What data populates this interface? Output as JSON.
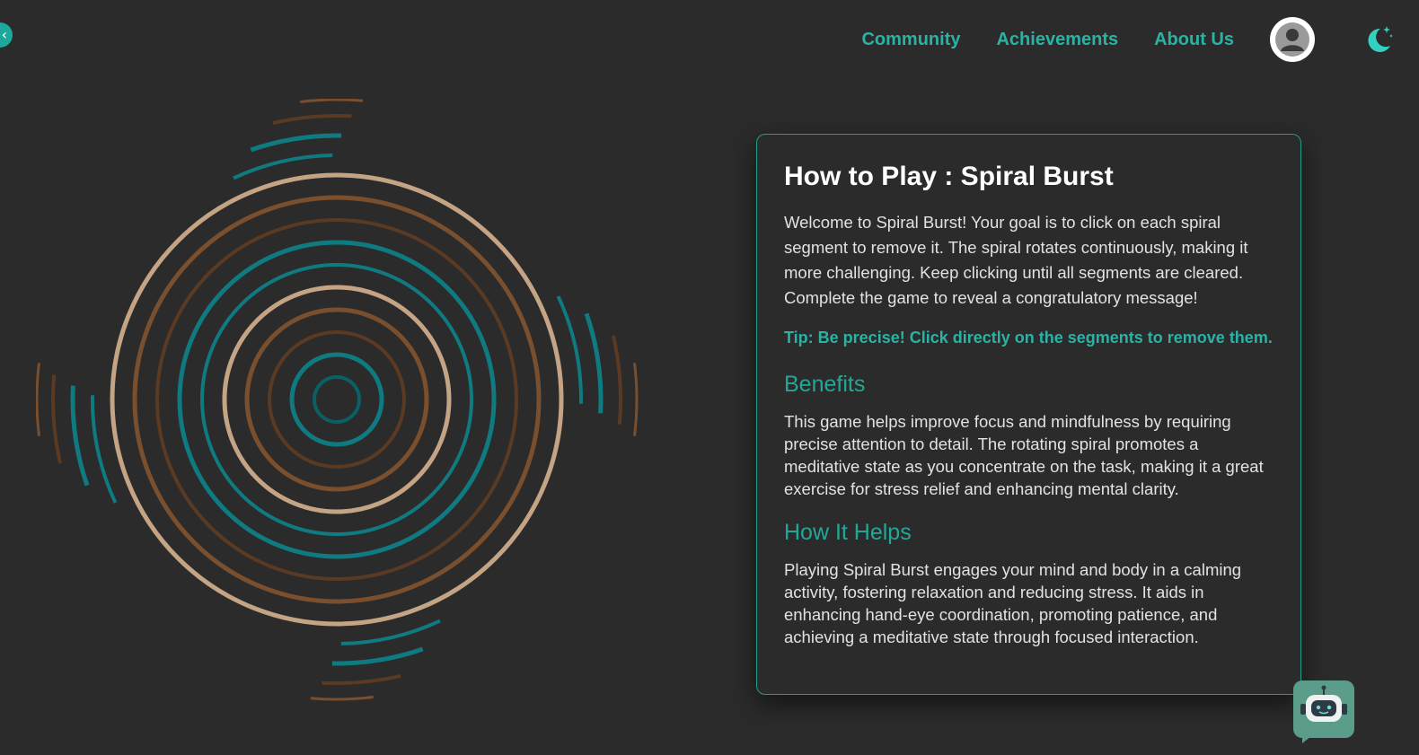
{
  "nav": {
    "items": [
      {
        "label": "Community"
      },
      {
        "label": "Achievements"
      },
      {
        "label": "About Us"
      }
    ],
    "avatar_icon": "user-avatar-icon",
    "theme_toggle_icon": "moon-stars-icon",
    "back_icon": "chevron-left-icon"
  },
  "card": {
    "title": "How to Play : Spiral Burst",
    "intro": "Welcome to Spiral Burst! Your goal is to click on each spiral segment to remove it. The spiral rotates continuously, making it more challenging. Keep clicking until all segments are cleared. Complete the game to reveal a congratulatory message!",
    "tip": "Tip: Be precise! Click directly on the segments to remove them.",
    "benefits_heading": "Benefits",
    "benefits_text": "This game helps improve focus and mindfulness by requiring precise attention to detail. The rotating spiral promotes a meditative state as you concentrate on the task, making it a great exercise for stress relief and enhancing mental clarity.",
    "helps_heading": "How It Helps",
    "helps_text": "Playing Spiral Burst engages your mind and body in a calming activity, fostering relaxation and reducing stress. It aids in enhancing hand-eye coordination, promoting patience, and achieving a meditative state through focused interaction."
  },
  "chatbot": {
    "icon": "robot-icon"
  },
  "colors": {
    "background": "#2b2b2b",
    "accent": "#2ab3a4",
    "ring_teal": "#0f7a80",
    "ring_brown": "#7a4f2e",
    "ring_darkbrown": "#5a3a22",
    "ring_tan": "#c4a484"
  }
}
